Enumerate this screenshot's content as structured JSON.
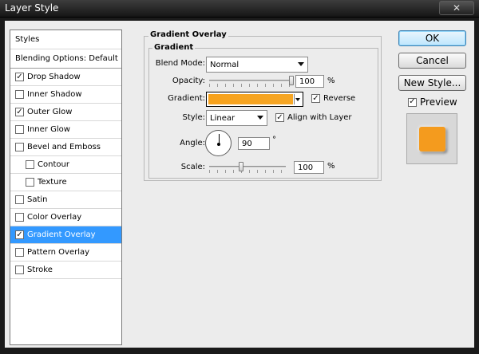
{
  "window": {
    "title": "Layer Style",
    "close_glyph": "✕"
  },
  "sidebar": {
    "header": "Styles",
    "blending": "Blending Options: Default",
    "items": [
      {
        "label": "Drop Shadow",
        "checked": true
      },
      {
        "label": "Inner Shadow",
        "checked": false
      },
      {
        "label": "Outer Glow",
        "checked": true
      },
      {
        "label": "Inner Glow",
        "checked": false
      },
      {
        "label": "Bevel and Emboss",
        "checked": false
      },
      {
        "label": "Contour",
        "checked": false,
        "sub": true
      },
      {
        "label": "Texture",
        "checked": false,
        "sub": true
      },
      {
        "label": "Satin",
        "checked": false
      },
      {
        "label": "Color Overlay",
        "checked": false
      },
      {
        "label": "Gradient Overlay",
        "checked": true,
        "selected": true
      },
      {
        "label": "Pattern Overlay",
        "checked": false
      },
      {
        "label": "Stroke",
        "checked": false
      }
    ]
  },
  "panel": {
    "group_title": "Gradient Overlay",
    "subgroup_title": "Gradient",
    "blend_mode": {
      "label": "Blend Mode:",
      "value": "Normal"
    },
    "opacity": {
      "label": "Opacity:",
      "value": "100",
      "unit": "%",
      "level": 1.0
    },
    "gradient": {
      "label": "Gradient:",
      "color_start": "#f7a21c",
      "color_end": "#f6a625"
    },
    "reverse": {
      "label": "Reverse",
      "checked": true
    },
    "style": {
      "label": "Style:",
      "value": "Linear"
    },
    "align_with_layer": {
      "label": "Align with Layer",
      "checked": true
    },
    "angle": {
      "label": "Angle:",
      "value": "90",
      "unit": "°"
    },
    "scale": {
      "label": "Scale:",
      "value": "100",
      "unit": "%",
      "level": 0.42
    }
  },
  "buttons": {
    "ok": "OK",
    "cancel": "Cancel",
    "new_style": "New Style..."
  },
  "preview": {
    "label": "Preview",
    "checked": true,
    "swatch_color": "#f49b1e"
  }
}
